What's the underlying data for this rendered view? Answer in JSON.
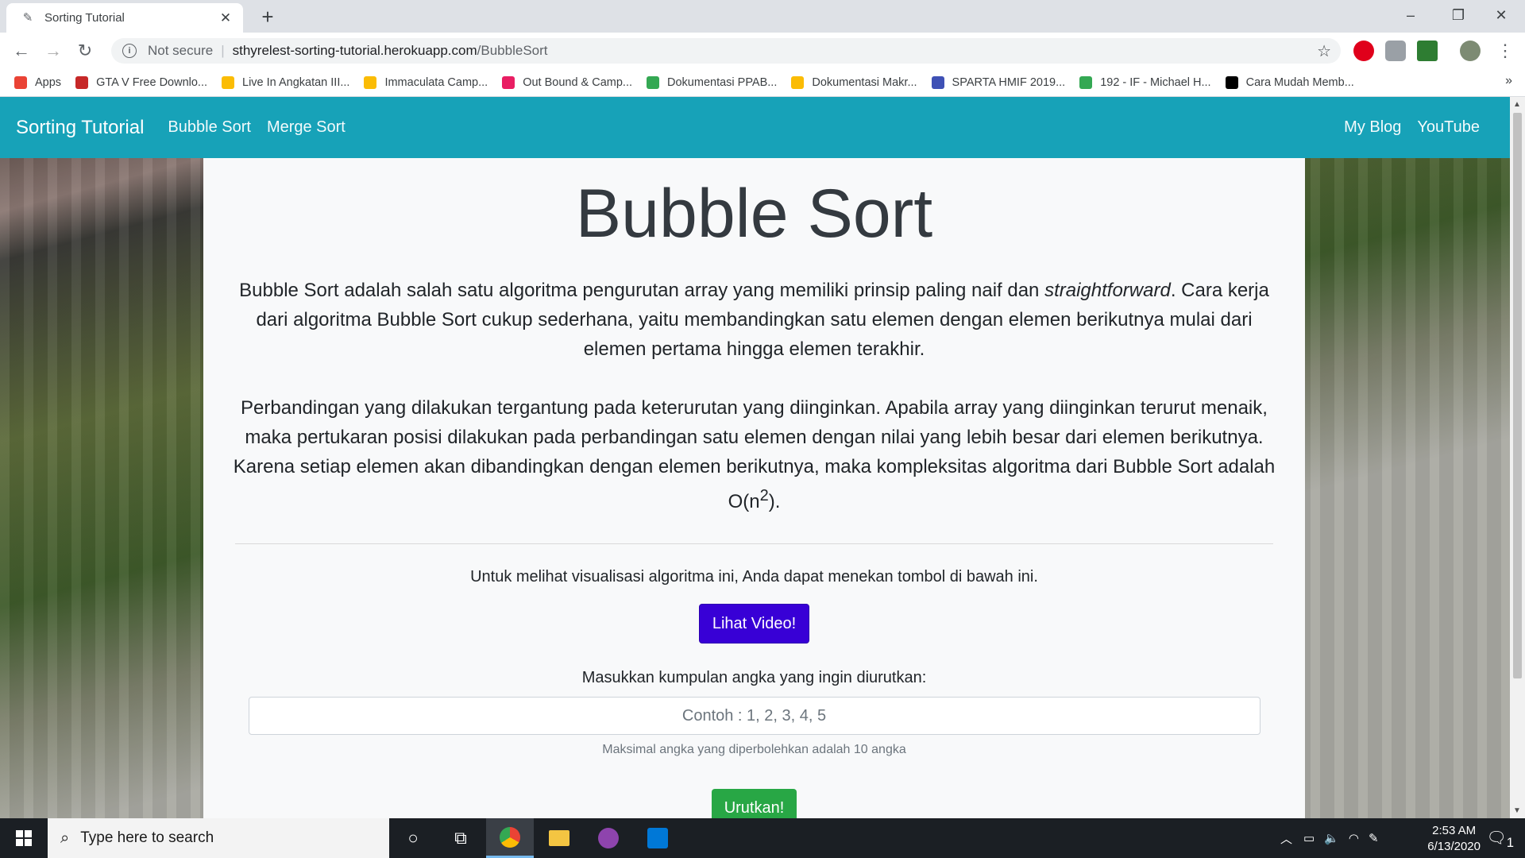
{
  "browser": {
    "tab_title": "Sorting Tutorial",
    "new_tab_symbol": "+",
    "omnibox": {
      "security_label": "Not secure",
      "separator": "|",
      "host": "sthyrelest-sorting-tutorial.herokuapp.com",
      "path": "/BubbleSort"
    },
    "bookmarks": [
      {
        "label": "Apps",
        "icon": "apps-grid-icon",
        "color": "#ea4335"
      },
      {
        "label": "GTA V Free Downlo...",
        "icon": "gamepad-icon",
        "color": "#c62828"
      },
      {
        "label": "Live In Angkatan III...",
        "icon": "pinwheel-icon",
        "color": "#fbbc05"
      },
      {
        "label": "Immaculata Camp...",
        "icon": "pinwheel-icon",
        "color": "#fbbc05"
      },
      {
        "label": "Out Bound & Camp...",
        "icon": "dots-icon",
        "color": "#e91e63"
      },
      {
        "label": "Dokumentasi PPAB...",
        "icon": "drive-icon",
        "color": "#34a853"
      },
      {
        "label": "Dokumentasi Makr...",
        "icon": "pinwheel-icon",
        "color": "#fbbc05"
      },
      {
        "label": "SPARTA HMIF 2019...",
        "icon": "forms-icon",
        "color": "#3f51b5"
      },
      {
        "label": "192 - IF - Michael H...",
        "icon": "drive-icon",
        "color": "#34a853"
      },
      {
        "label": "Cara Mudah Memb...",
        "icon": "medium-icon",
        "color": "#000000"
      }
    ],
    "bookmarks_overflow": "»"
  },
  "navbar": {
    "brand": "Sorting Tutorial",
    "links": [
      "Bubble Sort",
      "Merge Sort"
    ],
    "right_links": [
      "My Blog",
      "YouTube"
    ],
    "color": "#17a2b8"
  },
  "content": {
    "title": "Bubble Sort",
    "para1_a": "Bubble Sort adalah salah satu algoritma pengurutan array yang memiliki prinsip paling naif dan ",
    "para1_em": "straightforward",
    "para1_b": ". Cara kerja dari algoritma Bubble Sort cukup sederhana, yaitu membandingkan satu elemen dengan elemen berikutnya mulai dari elemen pertama hingga elemen terakhir.",
    "para2_a": "Perbandingan yang dilakukan tergantung pada keterurutan yang diinginkan. Apabila array yang diinginkan terurut menaik, maka pertukaran posisi dilakukan pada perbandingan satu elemen dengan nilai yang lebih besar dari elemen berikutnya. Karena setiap elemen akan dibandingkan dengan elemen berikutnya, maka kompleksitas algoritma dari Bubble Sort adalah O(n",
    "para2_sup": "2",
    "para2_b": ").",
    "viz_text": "Untuk melihat visualisasi algoritma ini, Anda dapat menekan tombol di bawah ini.",
    "video_button": "Lihat Video!",
    "input_label": "Masukkan kumpulan angka yang ingin diurutkan:",
    "input_placeholder": "Contoh : 1, 2, 3, 4, 5",
    "input_value": "",
    "hint": "Maksimal angka yang diperbolehkan adalah 10 angka",
    "sort_button": "Urutkan!",
    "video_button_color": "#3800d6",
    "sort_button_color": "#28a745"
  },
  "taskbar": {
    "search_placeholder": "Type here to search",
    "time": "2:53 AM",
    "date": "6/13/2020",
    "notification_count": "1"
  }
}
